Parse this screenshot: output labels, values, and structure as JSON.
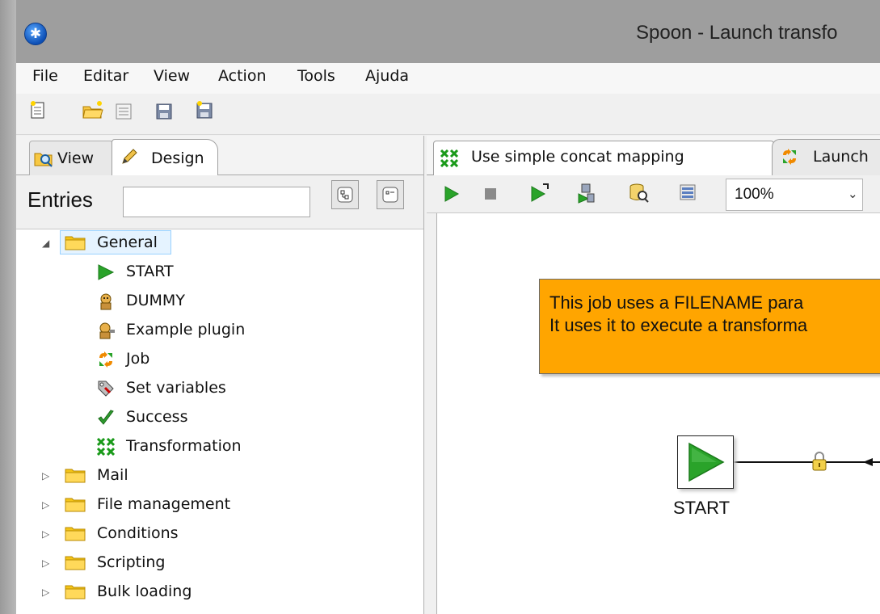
{
  "window": {
    "title": "Spoon - Launch transfo"
  },
  "menu": [
    "File",
    "Editar",
    "View",
    "Action",
    "Tools",
    "Ajuda"
  ],
  "left": {
    "tabs": {
      "view": "View",
      "design": "Design"
    },
    "entries_label": "Entries",
    "search_value": "",
    "tree": {
      "general": {
        "label": "General",
        "children": [
          "START",
          "DUMMY",
          "Example plugin",
          "Job",
          "Set variables",
          "Success",
          "Transformation"
        ]
      },
      "folders": [
        "Mail",
        "File management",
        "Conditions",
        "Scripting",
        "Bulk loading"
      ]
    }
  },
  "right": {
    "tabs": [
      "Use simple concat mapping",
      "Launch"
    ],
    "zoom": "100%",
    "note": {
      "line1": "This job uses a FILENAME para",
      "line2": "It uses it to execute a transforma"
    },
    "start_label": "START"
  },
  "colors": {
    "note_bg": "#ffa500",
    "run_green": "#2aa32a",
    "accent_folder": "#f5c518"
  }
}
